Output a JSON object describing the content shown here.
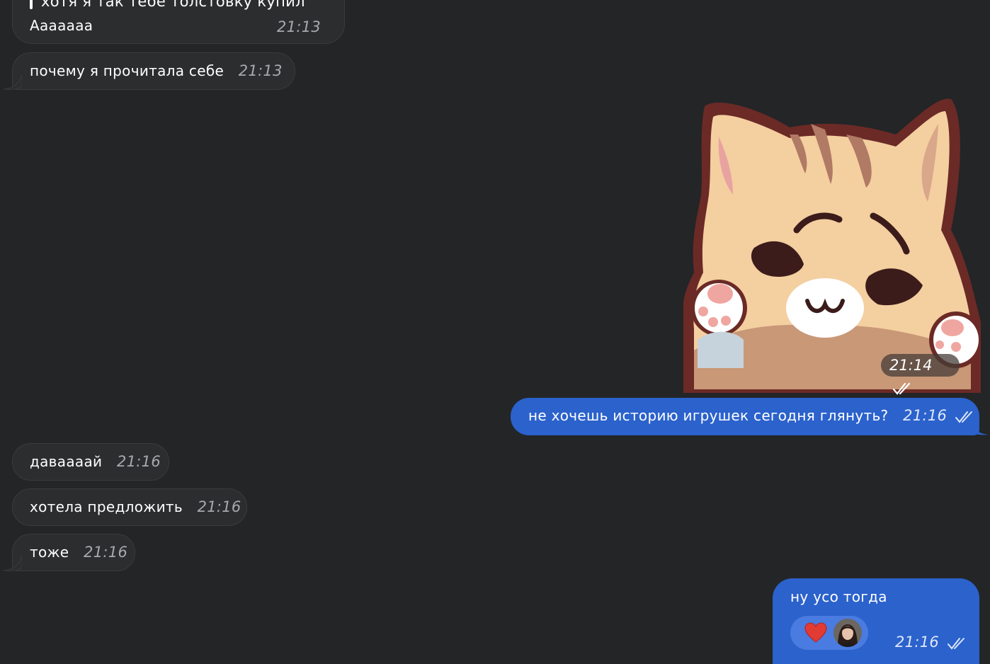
{
  "messages": {
    "m1": {
      "quote": "хотя я так тебе толстовку купил",
      "text": "Ааааааа",
      "time": "21:13"
    },
    "m2": {
      "text": "почему я прочитала себе",
      "time": "21:13"
    },
    "m3": {
      "time": "21:14"
    },
    "m4": {
      "text": "не хочешь историю игрушек сегодня глянуть?",
      "time": "21:16"
    },
    "m5": {
      "text": "даваааай",
      "time": "21:16"
    },
    "m6": {
      "text": "хотела предложить",
      "time": "21:16"
    },
    "m7": {
      "text": "тоже",
      "time": "21:16"
    },
    "m8": {
      "text": "ну усо тогда",
      "time": "21:16",
      "reactions": [
        "heart",
        "avatar"
      ]
    }
  },
  "colors": {
    "background": "#232527",
    "incoming_bubble": "#2c2d2f",
    "outgoing_bubble": "#2b62cc",
    "reaction_pill": "#4a7be0"
  },
  "icons": [
    "double-check-icon",
    "heart-reaction-icon",
    "user-avatar",
    "cat-sticker"
  ]
}
